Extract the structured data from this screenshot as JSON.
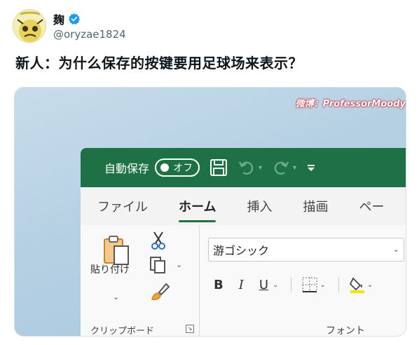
{
  "tweet": {
    "display_name": "麹",
    "handle": "@oryzae1824",
    "text": "新人：为什么保存的按键要用足球场来表示？"
  },
  "media": {
    "watermark": "微博：ProfessorMoody",
    "excel": {
      "autosave_label": "自動保存",
      "toggle_text": "オフ",
      "tabs": [
        {
          "label": "ファイル",
          "active": false
        },
        {
          "label": "ホーム",
          "active": true
        },
        {
          "label": "挿入",
          "active": false
        },
        {
          "label": "描画",
          "active": false
        },
        {
          "label": "ペー",
          "active": false
        }
      ],
      "clipboard": {
        "paste_label": "貼り付け",
        "group_label": "クリップボード"
      },
      "font": {
        "font_name": "游ゴシック",
        "bold": "B",
        "italic": "I",
        "underline": "U",
        "group_label": "フォント"
      },
      "colors": {
        "titlebar": "#1e7145",
        "highlight": "#f2e600",
        "verified": "#1d9bf0"
      }
    }
  }
}
